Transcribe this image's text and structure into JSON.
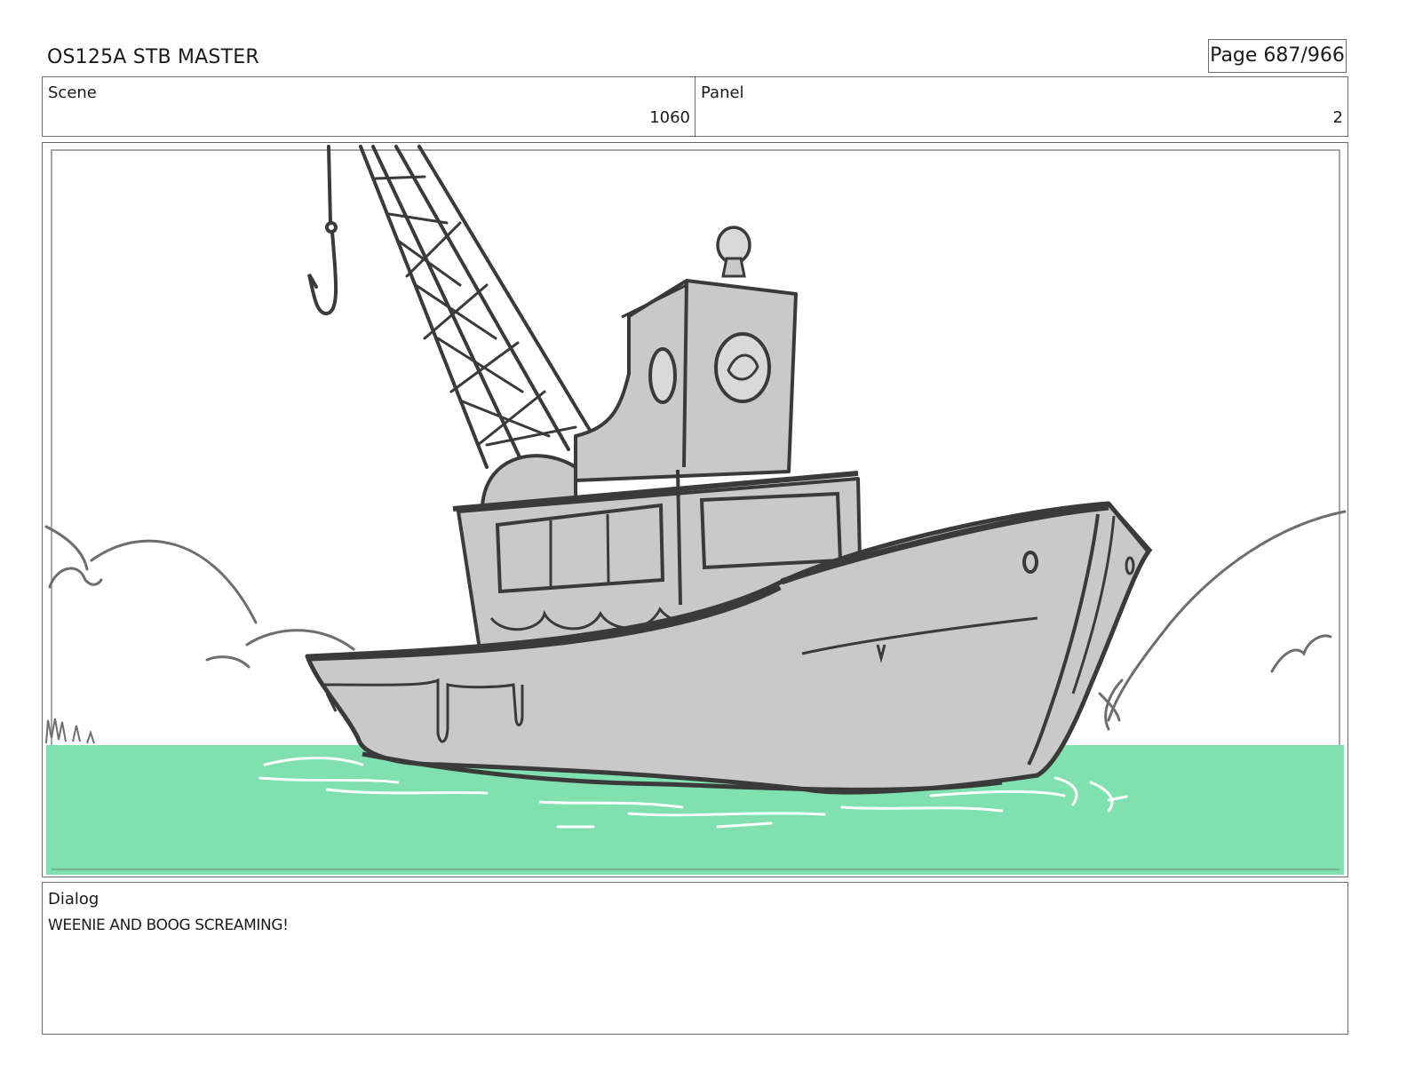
{
  "header": {
    "title": "OS125A STB MASTER",
    "page": "Page 687/966"
  },
  "scene": {
    "label": "Scene",
    "value": "1060"
  },
  "panel": {
    "label": "Panel",
    "value": "2"
  },
  "dialog": {
    "label": "Dialog",
    "text": "WEENIE AND BOOG SCREAMING!"
  },
  "colors": {
    "water": "#80e0b0",
    "boat_fill": "#c9c9c9",
    "line": "#3a3a3a",
    "border": "#6b6b6b"
  }
}
